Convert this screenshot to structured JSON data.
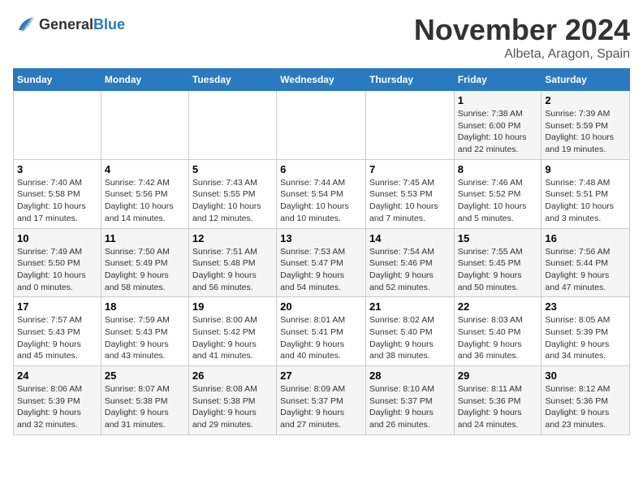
{
  "header": {
    "logo_general": "General",
    "logo_blue": "Blue",
    "month_title": "November 2024",
    "location": "Albeta, Aragon, Spain"
  },
  "weekdays": [
    "Sunday",
    "Monday",
    "Tuesday",
    "Wednesday",
    "Thursday",
    "Friday",
    "Saturday"
  ],
  "weeks": [
    [
      {
        "day": "",
        "info": ""
      },
      {
        "day": "",
        "info": ""
      },
      {
        "day": "",
        "info": ""
      },
      {
        "day": "",
        "info": ""
      },
      {
        "day": "",
        "info": ""
      },
      {
        "day": "1",
        "info": "Sunrise: 7:38 AM\nSunset: 6:00 PM\nDaylight: 10 hours\nand 22 minutes."
      },
      {
        "day": "2",
        "info": "Sunrise: 7:39 AM\nSunset: 5:59 PM\nDaylight: 10 hours\nand 19 minutes."
      }
    ],
    [
      {
        "day": "3",
        "info": "Sunrise: 7:40 AM\nSunset: 5:58 PM\nDaylight: 10 hours\nand 17 minutes."
      },
      {
        "day": "4",
        "info": "Sunrise: 7:42 AM\nSunset: 5:56 PM\nDaylight: 10 hours\nand 14 minutes."
      },
      {
        "day": "5",
        "info": "Sunrise: 7:43 AM\nSunset: 5:55 PM\nDaylight: 10 hours\nand 12 minutes."
      },
      {
        "day": "6",
        "info": "Sunrise: 7:44 AM\nSunset: 5:54 PM\nDaylight: 10 hours\nand 10 minutes."
      },
      {
        "day": "7",
        "info": "Sunrise: 7:45 AM\nSunset: 5:53 PM\nDaylight: 10 hours\nand 7 minutes."
      },
      {
        "day": "8",
        "info": "Sunrise: 7:46 AM\nSunset: 5:52 PM\nDaylight: 10 hours\nand 5 minutes."
      },
      {
        "day": "9",
        "info": "Sunrise: 7:48 AM\nSunset: 5:51 PM\nDaylight: 10 hours\nand 3 minutes."
      }
    ],
    [
      {
        "day": "10",
        "info": "Sunrise: 7:49 AM\nSunset: 5:50 PM\nDaylight: 10 hours\nand 0 minutes."
      },
      {
        "day": "11",
        "info": "Sunrise: 7:50 AM\nSunset: 5:49 PM\nDaylight: 9 hours\nand 58 minutes."
      },
      {
        "day": "12",
        "info": "Sunrise: 7:51 AM\nSunset: 5:48 PM\nDaylight: 9 hours\nand 56 minutes."
      },
      {
        "day": "13",
        "info": "Sunrise: 7:53 AM\nSunset: 5:47 PM\nDaylight: 9 hours\nand 54 minutes."
      },
      {
        "day": "14",
        "info": "Sunrise: 7:54 AM\nSunset: 5:46 PM\nDaylight: 9 hours\nand 52 minutes."
      },
      {
        "day": "15",
        "info": "Sunrise: 7:55 AM\nSunset: 5:45 PM\nDaylight: 9 hours\nand 50 minutes."
      },
      {
        "day": "16",
        "info": "Sunrise: 7:56 AM\nSunset: 5:44 PM\nDaylight: 9 hours\nand 47 minutes."
      }
    ],
    [
      {
        "day": "17",
        "info": "Sunrise: 7:57 AM\nSunset: 5:43 PM\nDaylight: 9 hours\nand 45 minutes."
      },
      {
        "day": "18",
        "info": "Sunrise: 7:59 AM\nSunset: 5:43 PM\nDaylight: 9 hours\nand 43 minutes."
      },
      {
        "day": "19",
        "info": "Sunrise: 8:00 AM\nSunset: 5:42 PM\nDaylight: 9 hours\nand 41 minutes."
      },
      {
        "day": "20",
        "info": "Sunrise: 8:01 AM\nSunset: 5:41 PM\nDaylight: 9 hours\nand 40 minutes."
      },
      {
        "day": "21",
        "info": "Sunrise: 8:02 AM\nSunset: 5:40 PM\nDaylight: 9 hours\nand 38 minutes."
      },
      {
        "day": "22",
        "info": "Sunrise: 8:03 AM\nSunset: 5:40 PM\nDaylight: 9 hours\nand 36 minutes."
      },
      {
        "day": "23",
        "info": "Sunrise: 8:05 AM\nSunset: 5:39 PM\nDaylight: 9 hours\nand 34 minutes."
      }
    ],
    [
      {
        "day": "24",
        "info": "Sunrise: 8:06 AM\nSunset: 5:39 PM\nDaylight: 9 hours\nand 32 minutes."
      },
      {
        "day": "25",
        "info": "Sunrise: 8:07 AM\nSunset: 5:38 PM\nDaylight: 9 hours\nand 31 minutes."
      },
      {
        "day": "26",
        "info": "Sunrise: 8:08 AM\nSunset: 5:38 PM\nDaylight: 9 hours\nand 29 minutes."
      },
      {
        "day": "27",
        "info": "Sunrise: 8:09 AM\nSunset: 5:37 PM\nDaylight: 9 hours\nand 27 minutes."
      },
      {
        "day": "28",
        "info": "Sunrise: 8:10 AM\nSunset: 5:37 PM\nDaylight: 9 hours\nand 26 minutes."
      },
      {
        "day": "29",
        "info": "Sunrise: 8:11 AM\nSunset: 5:36 PM\nDaylight: 9 hours\nand 24 minutes."
      },
      {
        "day": "30",
        "info": "Sunrise: 8:12 AM\nSunset: 5:36 PM\nDaylight: 9 hours\nand 23 minutes."
      }
    ]
  ]
}
